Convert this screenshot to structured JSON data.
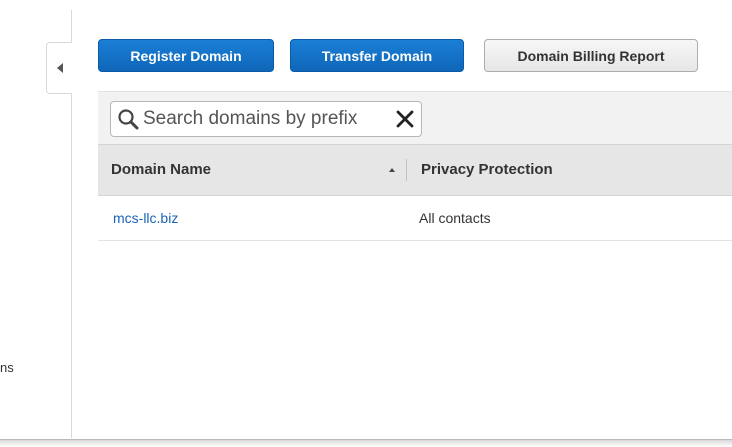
{
  "sidebar": {
    "collapse_toggle": "collapse-left",
    "partial_label": "ns"
  },
  "toolbar": {
    "register_label": "Register Domain",
    "transfer_label": "Transfer Domain",
    "billing_label": "Domain Billing Report"
  },
  "search": {
    "placeholder": "Search domains by prefix",
    "value": ""
  },
  "table": {
    "columns": [
      {
        "label": "Domain Name",
        "sort": "ascending"
      },
      {
        "label": "Privacy Protection"
      }
    ],
    "rows": [
      {
        "domain": "mcs-llc.biz",
        "privacy": "All contacts"
      }
    ]
  },
  "colors": {
    "primary_button": "#1470c8",
    "link": "#1a62b8",
    "header_bg": "#e6e6e6"
  }
}
